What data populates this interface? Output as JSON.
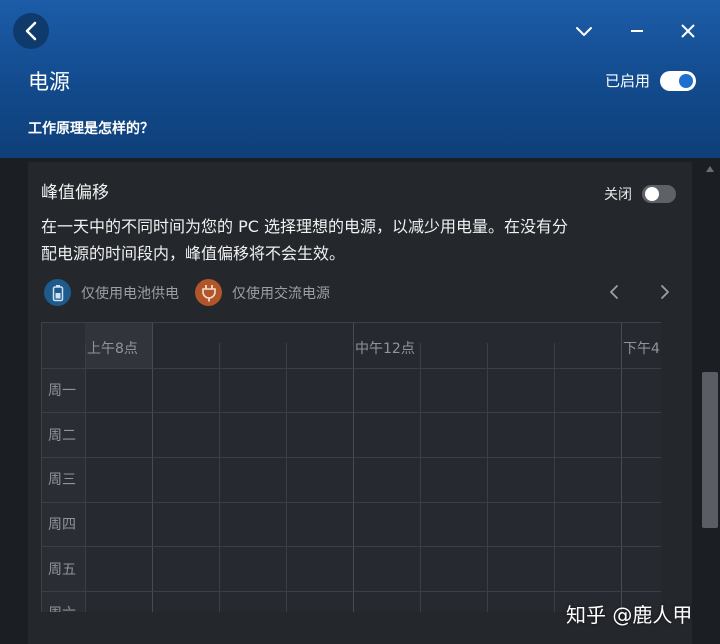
{
  "header": {
    "title": "电源",
    "enabled_label": "已启用",
    "enabled": true,
    "how_it_works": "工作原理是怎样的？"
  },
  "window_controls": [
    "chevron-down-icon",
    "minimize-icon",
    "close-icon"
  ],
  "peak_shift": {
    "title": "峰值偏移",
    "toggle_label": "关闭",
    "enabled": false,
    "description_line1": "在一天中的不同时间为您的 PC 选择理想的电源，以减少用电量。在没有分",
    "description_line2": "配电源的时间段内，峰值偏移将不会生效。",
    "legend": [
      {
        "label": "仅使用电池供电",
        "icon": "battery-icon",
        "color": "#1f5a8c"
      },
      {
        "label": "仅使用交流电源",
        "icon": "plug-icon",
        "color": "#b0562a"
      }
    ]
  },
  "schedule": {
    "time_labels": [
      "上午8点",
      "中午12点",
      "下午4"
    ],
    "days": [
      "周一",
      "周二",
      "周三",
      "周四",
      "周五",
      "周六"
    ]
  },
  "watermark": "知乎 @鹿人甲",
  "colors": {
    "header_blue": "#134c8f",
    "panel": "#24272c",
    "accent": "#1f6fd0"
  }
}
